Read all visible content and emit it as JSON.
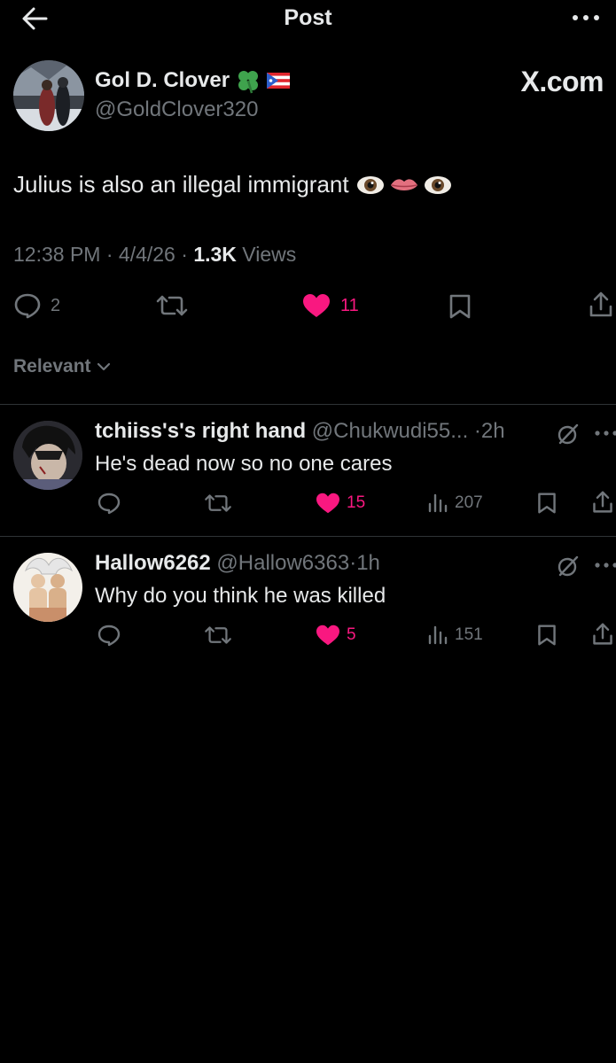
{
  "header": {
    "title": "Post"
  },
  "post": {
    "author_name": "Gol D. Clover",
    "author_handle": "@GoldClover320",
    "author_badges": [
      "four-leaf-clover-emoji",
      "puerto-rico-flag-emoji"
    ],
    "watermark": "X.com",
    "text": "Julius is also an illegal immigrant",
    "text_emojis": [
      "eyes-emoji",
      "lips-emoji",
      "eyes-emoji"
    ],
    "time": "12:38 PM",
    "date": "4/4/26",
    "views_count": "1.3K",
    "views_label": "Views",
    "sep": "·",
    "replies": "2",
    "likes": "11"
  },
  "sort": {
    "label": "Relevant"
  },
  "replies": [
    {
      "name": "tchiiss's's right hand",
      "handle": "@Chukwudi55...",
      "time": "2h",
      "text": "He's dead now so no one cares",
      "likes": "15",
      "views": "207"
    },
    {
      "name": "Hallow6262",
      "handle": "@Hallow6363",
      "time": "1h",
      "text": "Why do you think he was killed",
      "likes": "5",
      "views": "151"
    }
  ],
  "colors": {
    "background": "#000000",
    "text": "#e7e9ea",
    "muted": "#71767b",
    "like": "#f91880",
    "divider": "#2f3336"
  }
}
